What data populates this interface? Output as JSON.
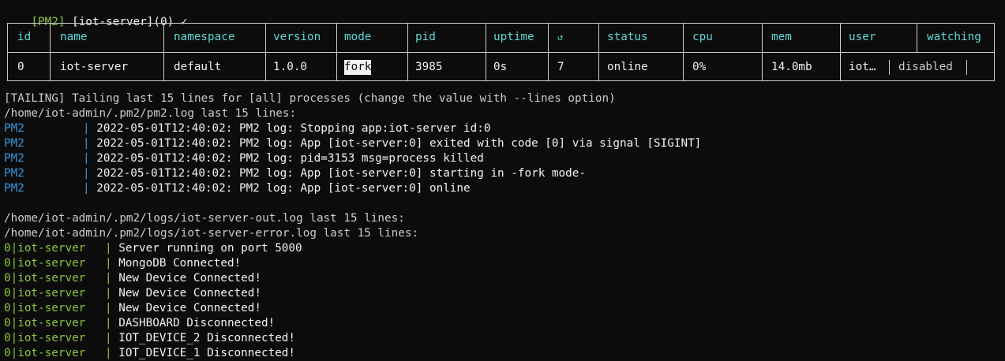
{
  "prompt": {
    "prefix": "[PM2]",
    "text": " [iot-server](0) ✓"
  },
  "table": {
    "headers": [
      "id",
      "name",
      "namespace",
      "version",
      "mode",
      "pid",
      "uptime",
      "↺",
      "status",
      "cpu",
      "mem",
      "user",
      "watching"
    ],
    "row": {
      "id": "0",
      "name": "iot-server",
      "namespace": "default",
      "version": "1.0.0",
      "mode": "fork",
      "pid": "3985",
      "uptime": "0s",
      "restarts": "7",
      "status": "online",
      "cpu": "0%",
      "mem": "14.0mb",
      "user": "iot…",
      "watching": "disabled"
    }
  },
  "tailing": "[TAILING] Tailing last 15 lines for [all] processes (change the value with --lines option)",
  "pm2_log_header": "/home/iot-admin/.pm2/pm2.log last 15 lines:",
  "pm2_logs": [
    {
      "tag": "PM2",
      "text": "2022-05-01T12:40:02: PM2 log: Stopping app:iot-server id:0"
    },
    {
      "tag": "PM2",
      "text": "2022-05-01T12:40:02: PM2 log: App [iot-server:0] exited with code [0] via signal [SIGINT]"
    },
    {
      "tag": "PM2",
      "text": "2022-05-01T12:40:02: PM2 log: pid=3153 msg=process killed"
    },
    {
      "tag": "PM2",
      "text": "2022-05-01T12:40:02: PM2 log: App [iot-server:0] starting in -fork mode-"
    },
    {
      "tag": "PM2",
      "text": "2022-05-01T12:40:02: PM2 log: App [iot-server:0] online"
    }
  ],
  "out_log_header": "/home/iot-admin/.pm2/logs/iot-server-out.log last 15 lines:",
  "err_log_header": "/home/iot-admin/.pm2/logs/iot-server-error.log last 15 lines:",
  "app_logs": [
    {
      "tag": "0|iot-server",
      "text": "Server running on port 5000"
    },
    {
      "tag": "0|iot-server",
      "text": "MongoDB Connected!"
    },
    {
      "tag": "0|iot-server",
      "text": "New Device Connected!"
    },
    {
      "tag": "0|iot-server",
      "text": "New Device Connected!"
    },
    {
      "tag": "0|iot-server",
      "text": "New Device Connected!"
    },
    {
      "tag": "0|iot-server",
      "text": "DASHBOARD Disconnected!"
    },
    {
      "tag": "0|iot-server",
      "text": "IOT_DEVICE_2 Disconnected!"
    },
    {
      "tag": "0|iot-server",
      "text": "IOT_DEVICE_1 Disconnected!"
    }
  ],
  "colors": {
    "background": "#0c0c0c",
    "text": "#cccccc",
    "green": "#8cc63e",
    "blue": "#3a96dd",
    "cyan": "#61d6d6"
  }
}
